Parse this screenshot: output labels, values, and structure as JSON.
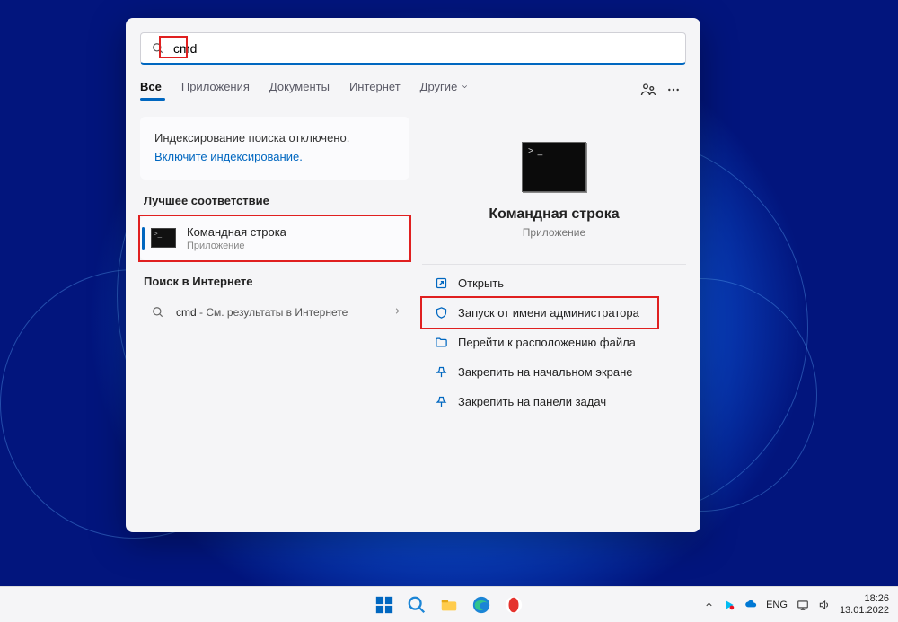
{
  "search": {
    "value": "cmd"
  },
  "tabs": {
    "all": "Все",
    "apps": "Приложения",
    "docs": "Документы",
    "web": "Интернет",
    "more": "Другие"
  },
  "notice": {
    "line": "Индексирование поиска отключено.",
    "link": "Включите индексирование."
  },
  "sections": {
    "bestMatch": "Лучшее соответствие",
    "webSearch": "Поиск в Интернете"
  },
  "bestMatch": {
    "title": "Командная строка",
    "subtitle": "Приложение"
  },
  "webResult": {
    "term": "cmd",
    "suffix": " - См. результаты в Интернете"
  },
  "preview": {
    "title": "Командная строка",
    "subtitle": "Приложение"
  },
  "actions": {
    "open": "Открыть",
    "runAdmin": "Запуск от имени администратора",
    "fileLocation": "Перейти к расположению файла",
    "pinStart": "Закрепить на начальном экране",
    "pinTaskbar": "Закрепить на панели задач"
  },
  "tray": {
    "lang": "ENG",
    "time": "18:26",
    "date": "13.01.2022"
  }
}
